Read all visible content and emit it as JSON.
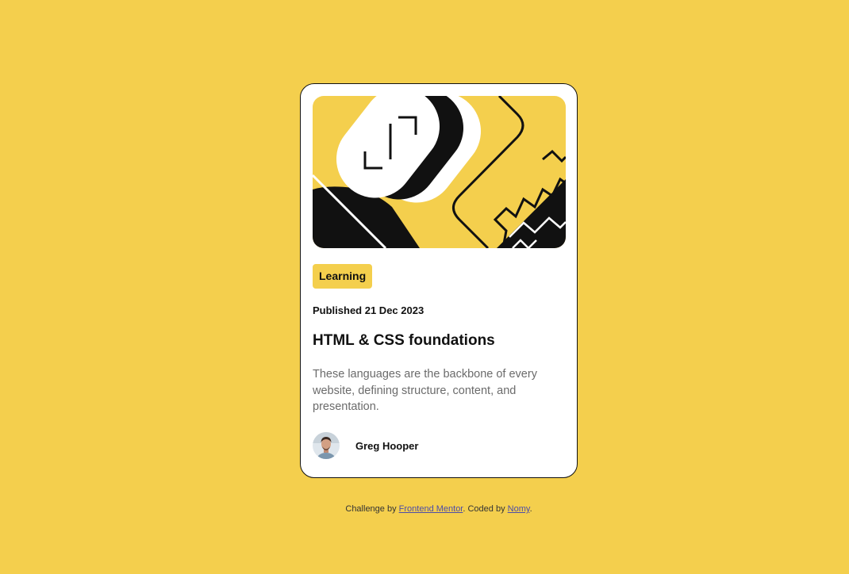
{
  "colors": {
    "background": "#f4cf4d",
    "card": "#ffffff",
    "ink": "#111111",
    "muted_text": "#6b6b6b",
    "link": "#4c4ca8"
  },
  "card": {
    "hero_illustration": "abstract-geometric-illustration",
    "tag": "Learning",
    "published": "Published 21 Dec 2023",
    "title": "HTML & CSS foundations",
    "description": "These languages are the backbone of every website, defining structure, content, and presentation.",
    "author": {
      "avatar": "author-avatar",
      "name": "Greg Hooper"
    }
  },
  "attribution": {
    "prefix": "Challenge by ",
    "challenge_link": "Frontend Mentor",
    "middle": ". Coded by ",
    "coder_link": "Nomy",
    "suffix": "."
  }
}
